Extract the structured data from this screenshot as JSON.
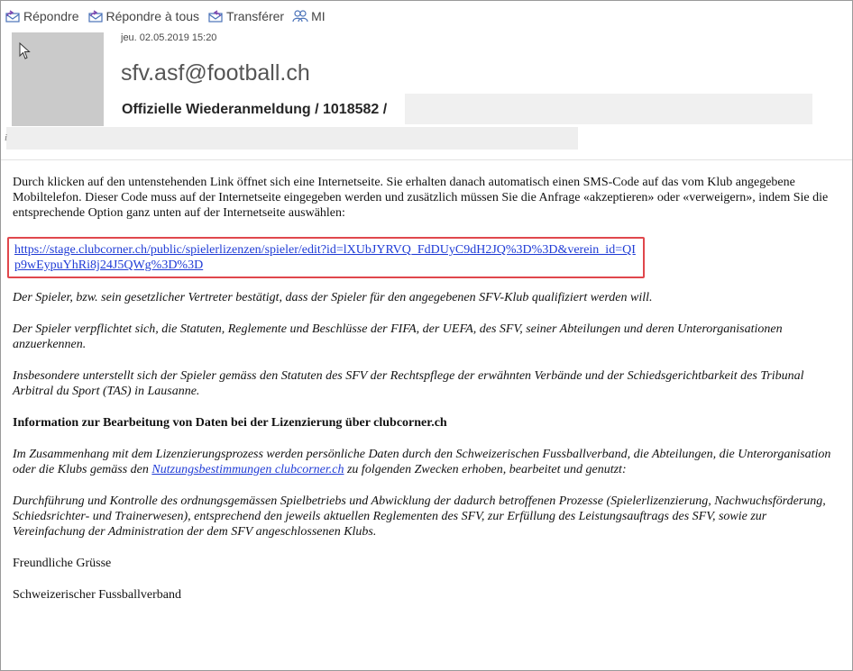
{
  "toolbar": {
    "reply": "Répondre",
    "reply_all": "Répondre à tous",
    "forward": "Transférer",
    "im": "MI"
  },
  "header": {
    "date": "jeu. 02.05.2019 15:20",
    "sender": "sfv.asf@football.ch",
    "subject": "Offizielle Wiederanmeldung / 1018582 /",
    "stray_mark": "i"
  },
  "body": {
    "intro": "Durch klicken auf den untenstehenden Link öffnet sich eine Internetseite. Sie erhalten danach automatisch einen SMS-Code auf das vom Klub angegebene Mobiltelefon. Dieser Code muss auf der Internetseite eingegeben werden und zusätzlich müssen Sie die Anfrage «akzeptieren» oder «verweigern», indem Sie die entsprechende Option ganz unten auf der Internetseite auswählen:",
    "link_text": "https://stage.clubcorner.ch/public/spielerlizenzen/spieler/edit?id=lXUbJYRVQ_FdDUyC9dH2JQ%3D%3D&verein_id=QIp9wEypuYhRi8j24J5QWg%3D%3D",
    "p_qualify": "Der Spieler, bzw. sein gesetzlicher Vertreter bestätigt, dass der Spieler für den angegebenen SFV-Klub qualifiziert werden will.",
    "p_statutes": "Der Spieler verpflichtet sich, die Statuten, Reglemente und Beschlüsse der FIFA, der UEFA, des SFV, seiner Abteilungen und deren Unterorganisationen anzuerkennen.",
    "p_jurisdiction": "Insbesondere unterstellt sich der Spieler gemäss den Statuten des SFV der Rechtspflege der erwähnten Verbände und der Schiedsgerichtbarkeit des Tribunal Arbitral du Sport (TAS) in Lausanne.",
    "info_heading": "Information zur Bearbeitung von Daten bei der Lizenzierung über clubcorner.ch",
    "p_data_before": "Im Zusammenhang mit dem Lizenzierungsprozess werden persönliche Daten durch den Schweizerischen Fussballverband, die Abteilungen, die Unterorganisation oder die Klubs gemäss den ",
    "p_data_link": "Nutzungsbestimmungen clubcorner.ch",
    "p_data_after": " zu folgenden Zwecken erhoben, bearbeitet und genutzt:",
    "p_purpose": "Durchführung und Kontrolle des ordnungsgemässen Spielbetriebs und Abwicklung der dadurch betroffenen Prozesse (Spielerlizenzierung, Nachwuchsförderung, Schiedsrichter- und Trainerwesen), entsprechend den jeweils aktuellen Reglementen des SFV, zur Erfüllung des Leistungsauftrags des SFV, sowie zur Vereinfachung der Administration der dem SFV angeschlossenen Klubs.",
    "greeting": "Freundliche Grüsse",
    "signature": "Schweizerischer Fussballverband"
  },
  "colors": {
    "link": "#1f3bd6",
    "highlight_border": "#e0474c",
    "avatar": "#cacaca"
  }
}
